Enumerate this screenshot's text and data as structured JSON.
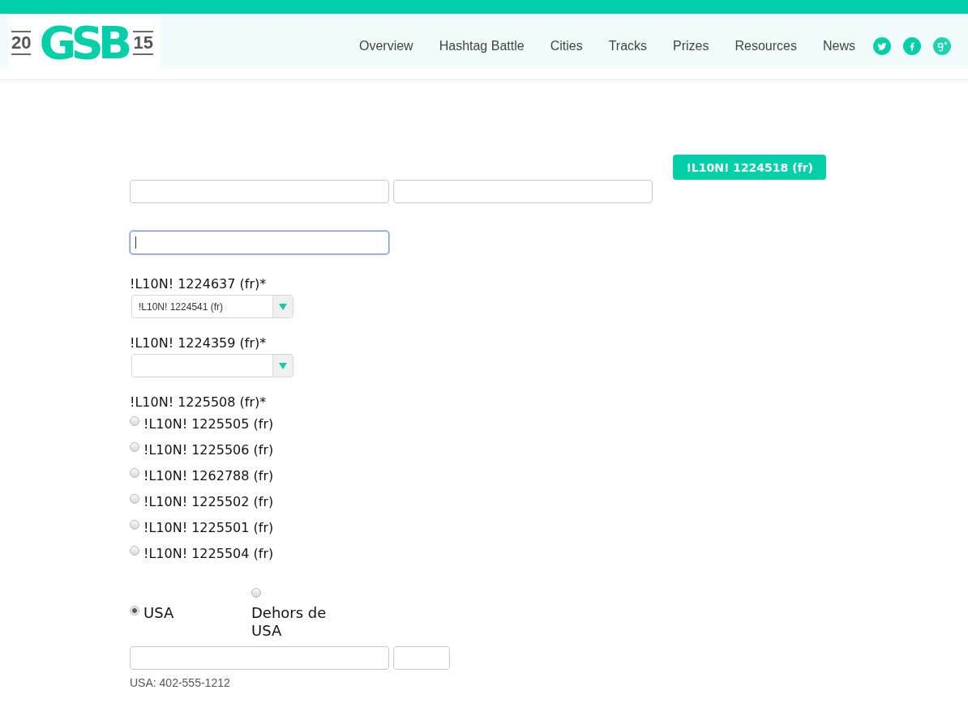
{
  "header": {
    "logo": {
      "left_year": "20",
      "mark": "GSB",
      "right_year": "15"
    },
    "nav": [
      {
        "label": "Overview"
      },
      {
        "label": "Hashtag Battle"
      },
      {
        "label": "Cities"
      },
      {
        "label": "Tracks"
      },
      {
        "label": "Prizes"
      },
      {
        "label": "Resources"
      },
      {
        "label": "News"
      }
    ],
    "social": [
      {
        "kind": "twitter"
      },
      {
        "kind": "facebook"
      },
      {
        "kind": "googleplus"
      }
    ]
  },
  "form": {
    "action_button": {
      "label": "!L10N! 1224518 (fr)"
    },
    "name_inputs": [
      {
        "focused": false
      },
      {
        "focused": false
      }
    ],
    "email_input": {
      "focused": true
    },
    "dropdowns": [
      {
        "label": "!L10N! 1224637 (fr)*",
        "value": "!L10N! 1224541 (fr)"
      },
      {
        "label": "!L10N! 1224359 (fr)*"
      }
    ],
    "choice_group": {
      "label": "!L10N! 1225508 (fr)*",
      "options": [
        {
          "label": "!L10N! 1225505 (fr)",
          "selected": false
        },
        {
          "label": "!L10N! 1225506 (fr)",
          "selected": false
        },
        {
          "label": "!L10N! 1262788 (fr)",
          "selected": false
        },
        {
          "label": "!L10N! 1225502 (fr)",
          "selected": false
        },
        {
          "label": "!L10N! 1225501 (fr)",
          "selected": false
        },
        {
          "label": "!L10N! 1225504 (fr)",
          "selected": false
        }
      ]
    },
    "location": [
      {
        "label": "USA",
        "selected": true
      },
      {
        "label": "Dehors de USA",
        "selected": false
      }
    ],
    "phone_inputs": [
      {
        "focused": false
      },
      {
        "focused": false
      }
    ],
    "phone_hint": "USA: 402-555-1212"
  }
}
